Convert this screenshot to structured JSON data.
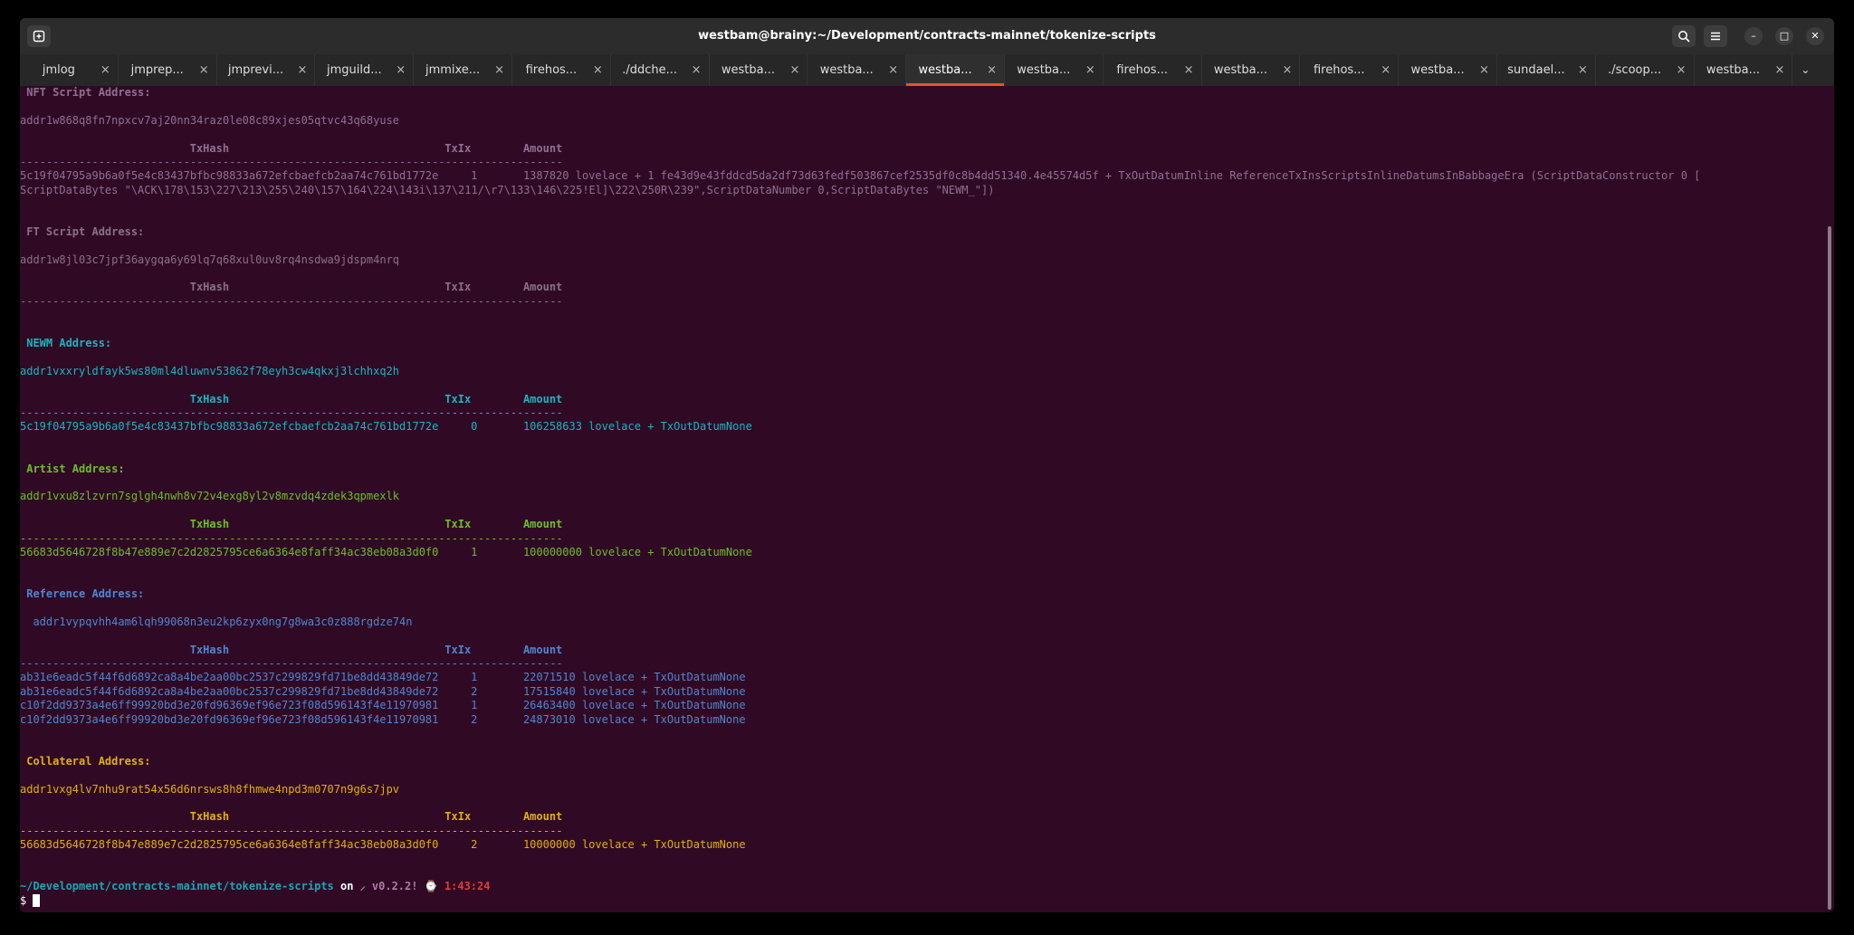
{
  "window": {
    "title": "westbam@brainy:~/Development/contracts-mainnet/tokenize-scripts",
    "new_tab_icon": "new-tab-icon",
    "search_icon": "search-icon",
    "menu_icon": "hamburger-menu-icon",
    "minimize_glyph": "–",
    "maximize_glyph": "□",
    "close_glyph": "✕"
  },
  "tabs": [
    {
      "label": "jmlog",
      "active": false
    },
    {
      "label": "jmprep...",
      "active": false
    },
    {
      "label": "jmprevi...",
      "active": false
    },
    {
      "label": "jmguild...",
      "active": false
    },
    {
      "label": "jmmixe...",
      "active": false
    },
    {
      "label": "firehos...",
      "active": false
    },
    {
      "label": "./ddche...",
      "active": false
    },
    {
      "label": "westba...",
      "active": false
    },
    {
      "label": "westba...",
      "active": false
    },
    {
      "label": "westba...",
      "active": true
    },
    {
      "label": "westba...",
      "active": false
    },
    {
      "label": "firehos...",
      "active": false
    },
    {
      "label": "westba...",
      "active": false
    },
    {
      "label": "firehos...",
      "active": false
    },
    {
      "label": "westba...",
      "active": false
    },
    {
      "label": "sundael...",
      "active": false
    },
    {
      "label": "./scoop...",
      "active": false
    },
    {
      "label": "westba...",
      "active": false
    }
  ],
  "tab_close_glyph": "×",
  "tab_overflow_glyph": "⌄",
  "colors": {
    "bg": "#300a24",
    "nft": "#8f6f94",
    "ft": "#8a7088",
    "newm": "#19b6c0",
    "artist": "#6cbf2a",
    "reference": "#4f86d0",
    "collateral": "#e0b00e",
    "path": "#1aa6b3",
    "git": "#b07aa8",
    "time": "#e53935",
    "white": "#ffffff"
  },
  "terminal": {
    "separator": "-----------------------------------------------------------------------------------",
    "col_headers": {
      "txhash": "TxHash",
      "txix": "TxIx",
      "amount": "Amount"
    },
    "sections": [
      {
        "key": "nft",
        "heading": " NFT Script Address:",
        "address": "addr1w868q8fn7npxcv7aj20nn34raz0le08c89xjes05qtvc43q68yuse",
        "rows": [
          {
            "hash": "5c19f04795a9b6a0f5e4c83437bfbc98833a672efcbaefcb2aa74c761bd1772e",
            "ix": "1",
            "amount": "1387820 lovelace + 1 fe43d9e43fddcd5da2df73d63fedf503867cef2535df0c8b4dd51340.4e45574d5f + TxOutDatumInline ReferenceTxInsScriptsInlineDatumsInBabbageEra (ScriptDataConstructor 0 [",
            "cont": "ScriptDataBytes \"\\ACK\\178\\153\\227\\213\\255\\240\\157\\164\\224\\143i\\137\\211/\\r7\\133\\146\\225!El]\\222\\250R\\239\",ScriptDataNumber 0,ScriptDataBytes \"NEWM_\"])"
          }
        ]
      },
      {
        "key": "ft",
        "heading": " FT Script Address:",
        "address": "addr1w8jl03c7jpf36aygqa6y69lq7q68xul0uv8rq4nsdwa9jdspm4nrq",
        "rows": []
      },
      {
        "key": "newm",
        "heading": " NEWM Address:",
        "address": "addr1vxxryldfayk5ws80ml4dluwnv53862f78eyh3cw4qkxj3lchhxq2h",
        "rows": [
          {
            "hash": "5c19f04795a9b6a0f5e4c83437bfbc98833a672efcbaefcb2aa74c761bd1772e",
            "ix": "0",
            "amount": "106258633 lovelace + TxOutDatumNone"
          }
        ]
      },
      {
        "key": "artist",
        "heading": " Artist Address:",
        "address": "addr1vxu8zlzvrn7sglgh4nwh8v72v4exg8yl2v8mzvdq4zdek3qpmexlk",
        "rows": [
          {
            "hash": "56683d5646728f8b47e889e7c2d2825795ce6a6364e8faff34ac38eb08a3d0f0",
            "ix": "1",
            "amount": "100000000 lovelace + TxOutDatumNone"
          }
        ]
      },
      {
        "key": "reference",
        "heading": " Reference Address:",
        "address": "  addr1vypqvhh4am6lqh99068n3eu2kp6zyx0ng7g8wa3c0z888rgdze74n",
        "rows": [
          {
            "hash": "ab31e6eadc5f44f6d6892ca8a4be2aa00bc2537c299829fd71be8dd43849de72",
            "ix": "1",
            "amount": "22071510 lovelace + TxOutDatumNone"
          },
          {
            "hash": "ab31e6eadc5f44f6d6892ca8a4be2aa00bc2537c299829fd71be8dd43849de72",
            "ix": "2",
            "amount": "17515840 lovelace + TxOutDatumNone"
          },
          {
            "hash": "c10f2dd9373a4e6ff99920bd3e20fd96369ef96e723f08d596143f4e11970981",
            "ix": "1",
            "amount": "26463400 lovelace + TxOutDatumNone"
          },
          {
            "hash": "c10f2dd9373a4e6ff99920bd3e20fd96369ef96e723f08d596143f4e11970981",
            "ix": "2",
            "amount": "24873010 lovelace + TxOutDatumNone"
          }
        ]
      },
      {
        "key": "collateral",
        "heading": " Collateral Address:",
        "address": "addr1vxg4lv7nhu9rat54x56d6nrsws8h8fhmwe4npd3m0707n9g6s7jpv",
        "rows": [
          {
            "hash": "56683d5646728f8b47e889e7c2d2825795ce6a6364e8faff34ac38eb08a3d0f0",
            "ix": "2",
            "amount": "10000000 lovelace + TxOutDatumNone"
          }
        ]
      }
    ],
    "prompt": {
      "path": "~/Development/contracts-mainnet/tokenize-scripts",
      "on": " on ",
      "git": "⸝ v0.2.2!",
      "watch": " ⌚ ",
      "time": "1:43:24",
      "symbol": "$ "
    }
  }
}
